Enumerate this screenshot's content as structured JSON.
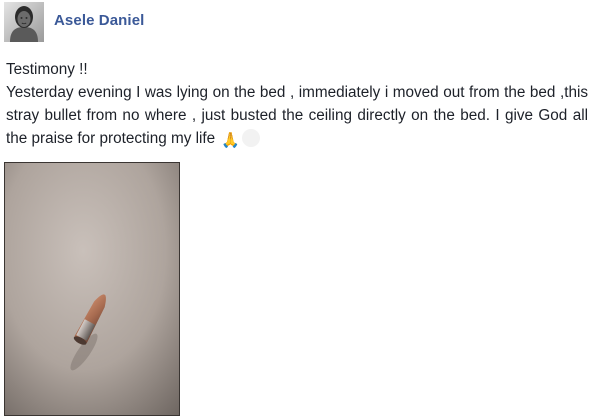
{
  "post": {
    "author": "Asele Daniel",
    "title_line": "Testimony !!",
    "body": "Yesterday evening I was lying on the bed , immediately i moved out from the bed ,this stray bullet from no where , just busted the ceiling directly on the bed. I give God all the praise for protecting my life",
    "emoji": "🙏",
    "avatar_icon": "profile-photo",
    "photo_subject": "bullet-on-ceiling-photo"
  },
  "colors": {
    "author_link": "#3b5998",
    "text": "#1d2129",
    "background": "#ffffff"
  }
}
